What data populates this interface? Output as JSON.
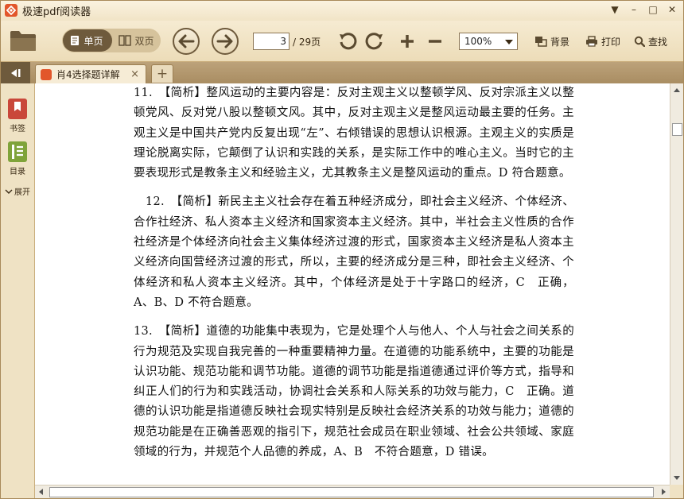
{
  "app": {
    "title": "极速pdf阅读器"
  },
  "window_controls": {
    "menu": "▼",
    "minimize": "–",
    "maximize": "□",
    "close": "✕"
  },
  "toolbar": {
    "single_page_label": "单页",
    "double_page_label": "双页",
    "current_page": "3",
    "total_pages": "/ 29页",
    "zoom": "100%",
    "background_label": "背景",
    "print_label": "打印",
    "find_label": "查找"
  },
  "tabs": [
    {
      "label": "肖4选择题详解",
      "close": "×"
    }
  ],
  "new_tab": "+",
  "sidebar": {
    "bookmarks_label": "书签",
    "toc_label": "目录",
    "expand_label": "展开"
  },
  "document": {
    "paragraphs": [
      "11.　【简析】整风运动的主要内容是：反对主观主义以整顿学风、反对宗派主义以整顿党风、反对党八股以整顿文风。其中，反对主观主义是整风运动最主要的任务。主观主义是中国共产党内反复出现“左”、右倾错误的思想认识根源。主观主义的实质是理论脱离实际，它颠倒了认识和实践的关系，是实际工作中的唯心主义。当时它的主要表现形式是教条主义和经验主义，尤其教条主义是整风运动的重点。D 符合题意。",
      "　12.　【简析】新民主主义社会存在着五种经济成分，即社会主义经济、个体经济、合作社经济、私人资本主义经济和国家资本主义经济。其中，半社会主义性质的合作社经济是个体经济向社会主义集体经济过渡的形式，国家资本主义经济是私人资本主义经济向国营经济过渡的形式，所以，主要的经济成分是三种，即社会主义经济、个体经济和私人资本主义经济。其中，个体经济是处于十字路口的经济，C　正确，A、B、D 不符合题意。",
      "13.　【简析】道德的功能集中表现为，它是处理个人与他人、个人与社会之间关系的行为规范及实现自我完善的一种重要精神力量。在道德的功能系统中，主要的功能是认识功能、规范功能和调节功能。道德的调节功能是指道德通过评价等方式，指导和纠正人们的行为和实践活动，协调社会关系和人际关系的功效与能力，C　正确。道德的认识功能是指道德反映社会现实特别是反映社会经济关系的功效与能力；道德的规范功能是在正确善恶观的指引下，规范社会成员在职业领域、社会公共领域、家庭领域的行为，并规范个人品德的养成，A、B　不符合题意，D 错误。"
    ]
  },
  "colors": {
    "accent": "#e2562b",
    "toolbar_bg": "#f1e4c6",
    "dark_brown": "#6e5a3c"
  }
}
